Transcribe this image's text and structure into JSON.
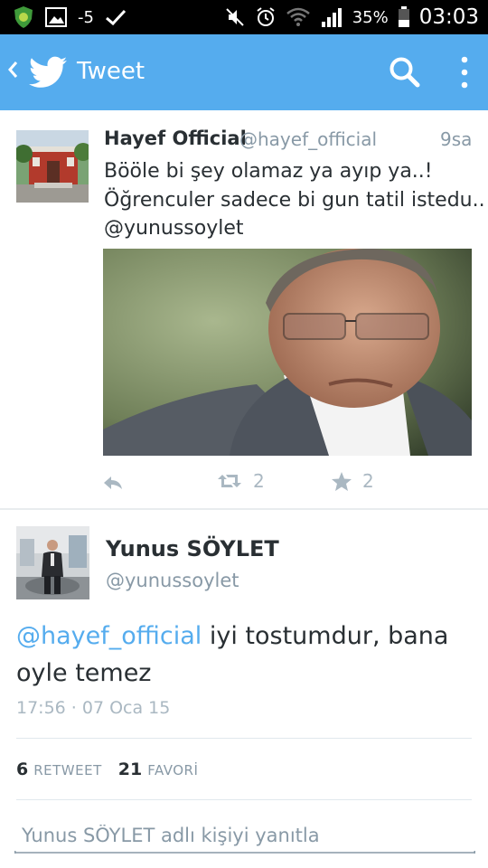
{
  "status_bar": {
    "temperature": "-5",
    "battery": "35%",
    "clock": "03:03",
    "icons": [
      "shield-app-icon",
      "gallery-icon",
      "check-icon",
      "mute-icon",
      "alarm-icon",
      "wifi-icon",
      "signal-icon",
      "battery-icon"
    ]
  },
  "app_bar": {
    "title": "Tweet",
    "icons": [
      "back-icon",
      "twitter-bird-icon",
      "search-icon",
      "more-vert-icon"
    ],
    "brand_color": "#55acee"
  },
  "quoted_tweet": {
    "name": "Hayef Official",
    "handle": "@hayef_official",
    "time": "9sa",
    "text_lines": [
      "Bööle bi şey olamaz ya ayıp ya..!",
      "Öğrenculer sadece bi gun tatil istedu..",
      "@yunussoylet"
    ],
    "retweets": "2",
    "favorites": "2"
  },
  "main_tweet": {
    "name": "Yunus SÖYLET",
    "handle": "@yunussoylet",
    "mention": "@hayef_official",
    "text_rest": " iyi tostumdur, bana",
    "text_line2": "oyle temez",
    "timestamp": "17:56 · 07 Oca 15",
    "retweet_count": "6",
    "retweet_label": "RETWEET",
    "favorite_count": "21",
    "favorite_label": "FAVORİ"
  },
  "reply": {
    "placeholder": "Yunus SÖYLET adlı kişiyi yanıtla"
  },
  "colors": {
    "link": "#55acee",
    "muted": "#8899a6",
    "text": "#292f33"
  }
}
